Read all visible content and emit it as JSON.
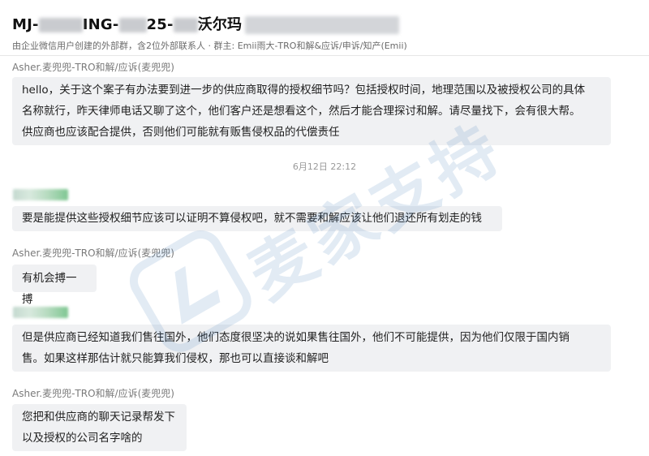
{
  "header": {
    "title_parts": [
      "MJ-",
      "ING-",
      "25-",
      "沃尔玛"
    ],
    "subtitle": "由企业微信用户创建的外部群，含2位外部联系人 · 群主: Emii雨大-TRO和解&应诉/申诉/知产(Emii)"
  },
  "messages": [
    {
      "sender": "Asher.麦兜兜-TRO和解/应诉(麦兜兜)",
      "lines": [
        "hello，关于这个案子有办法要到进一步的供应商取得的授权细节吗？包括授权时间，地理范围以及被授权公司的具体",
        "名称就行，昨天律师电话又聊了这个，他们客户还是想看这个，然后才能合理探讨和解。请尽量找下，会有很大帮。",
        "供应商也应该配合提供，否则他们可能就有贩售侵权品的代偿责任"
      ]
    },
    {
      "lines": [
        "要是能提供这些授权细节应该可以证明不算侵权吧，就不需要和解应该让他们退还所有划走的钱"
      ]
    },
    {
      "sender": "Asher.麦兜兜-TRO和解/应诉(麦兜兜)",
      "lines": [
        "有机会搏一搏"
      ]
    },
    {
      "lines": [
        "但是供应商已经知道我们售往国外，他们态度很坚决的说如果售往国外，他们不可能提供，因为他们仅限于国内销",
        "售。如果这样那估计就只能算我们侵权，那也可以直接谈和解吧"
      ]
    },
    {
      "sender": "Asher.麦兜兜-TRO和解/应诉(麦兜兜)",
      "lines": [
        "您把和供应商的聊天记录帮发下",
        "以及授权的公司名字啥的"
      ]
    }
  ],
  "timestamp": "6月12日 22:12",
  "watermark": {
    "text": "麦家支持"
  }
}
